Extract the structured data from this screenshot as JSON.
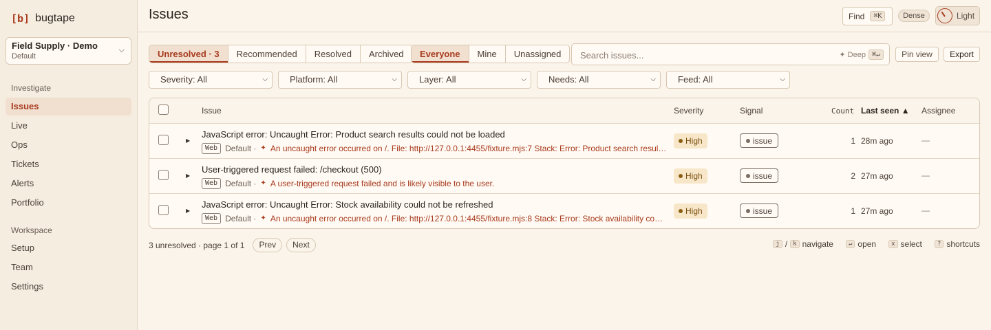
{
  "app": {
    "brand_mark": "[b]",
    "brand_name": "bugtape",
    "project": {
      "name": "Field Supply · Demo",
      "env": "Default"
    }
  },
  "sidebar": {
    "sections": [
      {
        "label": "Investigate",
        "items": [
          "Issues",
          "Live",
          "Ops",
          "Tickets",
          "Alerts",
          "Portfolio"
        ]
      },
      {
        "label": "Workspace",
        "items": [
          "Setup",
          "Team",
          "Settings"
        ]
      }
    ],
    "active": "Issues"
  },
  "header": {
    "title": "Issues",
    "find_label": "Find",
    "find_kbd": "⌘K",
    "dense_label": "Dense",
    "theme_label": "Light"
  },
  "status_tabs": [
    "Unresolved · 3",
    "Recommended",
    "Resolved",
    "Archived"
  ],
  "owner_tabs": [
    "Everyone",
    "Mine",
    "Unassigned"
  ],
  "search": {
    "placeholder": "Search issues...",
    "deep_label": "✦ Deep",
    "deep_kbd": "⌘↵"
  },
  "actions": {
    "pin": "Pin view",
    "export": "Export"
  },
  "filters": [
    "Severity: All",
    "Platform: All",
    "Layer: All",
    "Needs: All",
    "Feed: All"
  ],
  "table": {
    "columns": {
      "issue": "Issue",
      "severity": "Severity",
      "signal": "Signal",
      "count": "Count",
      "last_seen": "Last seen ▲",
      "assignee": "Assignee"
    },
    "rows": [
      {
        "title": "JavaScript error: Uncaught Error: Product search results could not be loaded",
        "platform": "Web",
        "env": "Default ·",
        "spark": "✦",
        "message": "An uncaught error occurred on /. File: http://127.0.0.1:4455/fixture.mjs:7 Stack: Error: Product search results could not be loaded",
        "severity": "High",
        "signal": "issue",
        "count": "1",
        "last_seen": "28m ago",
        "assignee": "—"
      },
      {
        "title": "User-triggered request failed: /checkout (500)",
        "platform": "Web",
        "env": "Default ·",
        "spark": "✦",
        "message": "A user-triggered request failed and is likely visible to the user.",
        "severity": "High",
        "signal": "issue",
        "count": "2",
        "last_seen": "27m ago",
        "assignee": "—"
      },
      {
        "title": "JavaScript error: Uncaught Error: Stock availability could not be refreshed",
        "platform": "Web",
        "env": "Default ·",
        "spark": "✦",
        "message": "An uncaught error occurred on /. File: http://127.0.0.1:4455/fixture.mjs:8 Stack: Error: Stock availability could not be refreshed",
        "severity": "High",
        "signal": "issue",
        "count": "1",
        "last_seen": "27m ago",
        "assignee": "—"
      }
    ]
  },
  "footer": {
    "summary": "3 unresolved · page 1 of 1",
    "prev": "Prev",
    "next": "Next",
    "shortcuts": {
      "j": "j",
      "k": "k",
      "navigate": "navigate",
      "enter": "↵",
      "open": "open",
      "x": "x",
      "select": "select",
      "q": "?",
      "shortcuts": "shortcuts"
    }
  }
}
